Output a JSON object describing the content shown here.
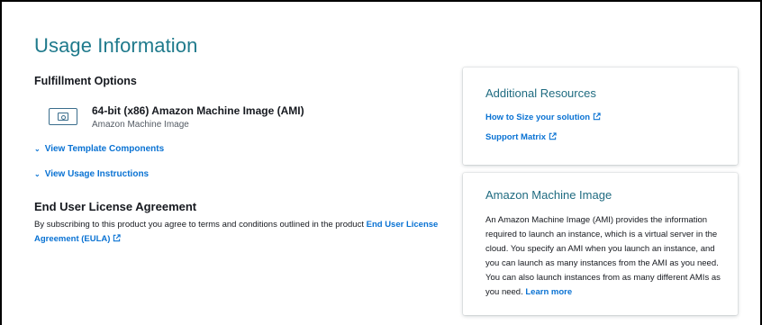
{
  "page": {
    "title": "Usage Information"
  },
  "fulfillment": {
    "heading": "Fulfillment Options",
    "option": {
      "title": "64-bit (x86) Amazon Machine Image (AMI)",
      "subtitle": "Amazon Machine Image",
      "icon": "ami-icon"
    },
    "view_template_components": "View Template Components",
    "view_usage_instructions": "View Usage Instructions"
  },
  "eula": {
    "heading": "End User License Agreement",
    "body_text": "By subscribing to this product you agree to terms and conditions outlined in the product ",
    "link_text": "End User License Agreement (EULA)"
  },
  "additional_resources": {
    "title": "Additional Resources",
    "links": [
      "How to Size your solution",
      "Support Matrix"
    ]
  },
  "ami_info": {
    "title": "Amazon Machine Image",
    "body_text": "An Amazon Machine Image (AMI) provides the information required to launch an instance, which is a virtual server in the cloud. You specify an AMI when you launch an instance, and you can launch as many instances from the AMI as you need. You can also launch instances from as many different AMIs as you need. ",
    "learn_more": "Learn more"
  },
  "colors": {
    "title_teal": "#1f7a8c",
    "link_blue": "#0972d3",
    "text_dark": "#16191f",
    "text_muted": "#545b64"
  }
}
